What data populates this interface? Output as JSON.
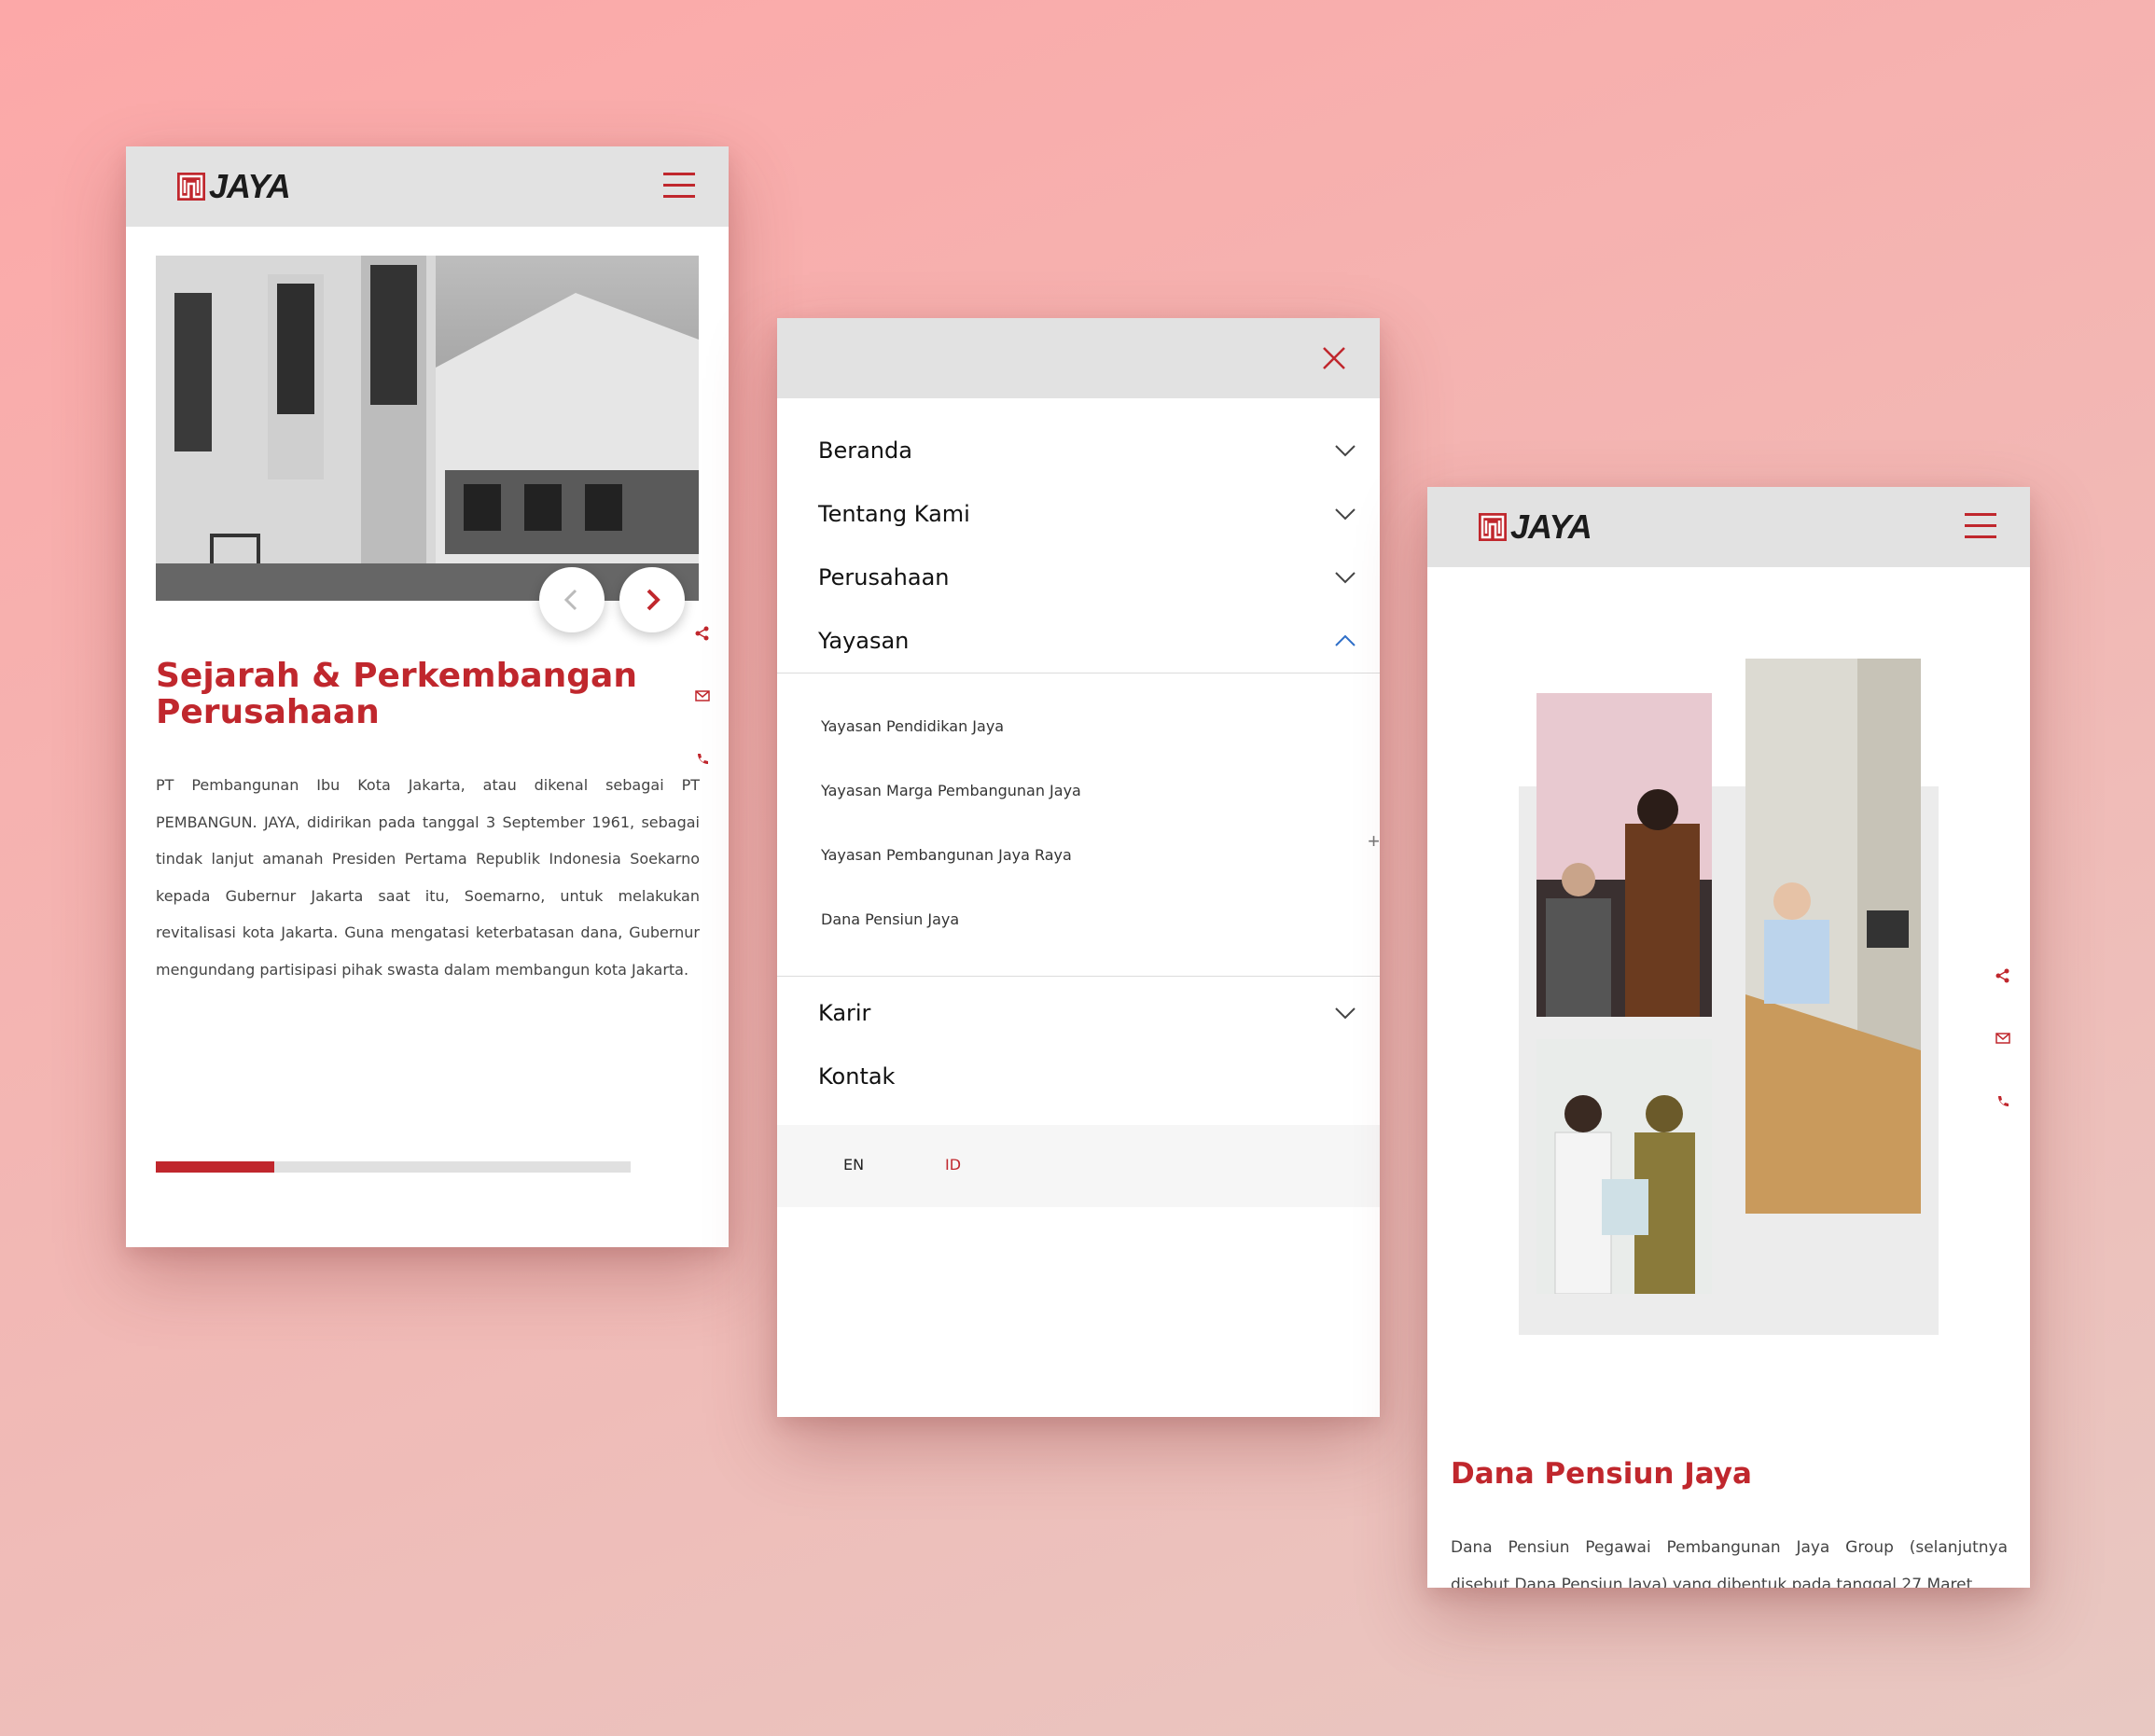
{
  "brand": {
    "logo_text": "JAYA",
    "accent_color": "#c0272d"
  },
  "screen1": {
    "title": "Sejarah & Perkembangan Perusahaan",
    "body": "PT Pembangunan Ibu Kota Jakarta, atau dikenal sebagai PT PEMBANGUN. JAYA, didirikan pada tanggal 3 September 1961, sebagai tindak lanjut amanah Presiden Pertama Republik Indonesia Soekarno kepada Gubernur Jakarta saat itu, Soemarno, untuk melakukan revitalisasi kota Jakarta. Guna mengatasi keterbatasan dana, Gubernur mengundang partisipasi pihak swasta dalam membangun kota Jakarta.",
    "progress": 0.25,
    "icons": [
      "share-icon",
      "mail-icon",
      "phone-icon",
      "chevron-left-icon",
      "chevron-right-icon",
      "menu-icon"
    ]
  },
  "screen2": {
    "menu": [
      {
        "label": "Beranda"
      },
      {
        "label": "Tentang Kami"
      },
      {
        "label": "Perusahaan"
      },
      {
        "label": "Yayasan"
      },
      {
        "label": "Karir"
      },
      {
        "label": "Kontak"
      }
    ],
    "yayasan_sub": [
      "Yayasan Pendidikan Jaya",
      "Yayasan Marga Pembangunan Jaya",
      "Yayasan Pembangunan Jaya Raya",
      "Dana Pensiun Jaya"
    ],
    "languages": {
      "en": "EN",
      "id": "ID",
      "active": "ID"
    }
  },
  "screen3": {
    "title": "Dana Pensiun Jaya",
    "body": "Dana Pensiun Pegawai Pembangunan Jaya Group (selanjutnya disebut Dana Pensiun Jaya) yang dibentuk pada tanggal 27 Maret"
  }
}
